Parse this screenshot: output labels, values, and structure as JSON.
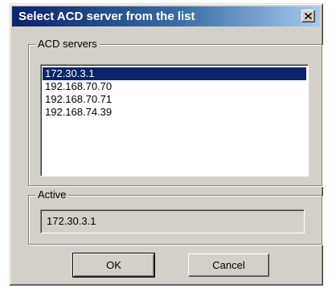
{
  "window": {
    "title": "Select ACD server from the list",
    "close_icon": "close-x"
  },
  "servers_group": {
    "label": "ACD servers",
    "items": [
      "172.30.3.1",
      "192.168.70.70",
      "192.168.70.71",
      "192.168.74.39"
    ],
    "selected_index": 0
  },
  "active_group": {
    "label": "Active",
    "value": "172.30.3.1"
  },
  "buttons": {
    "ok": "OK",
    "cancel": "Cancel"
  },
  "colors": {
    "title_start": "#0a246a",
    "title_end": "#a6caf0",
    "selection": "#0a246a",
    "face": "#d4d0c8"
  }
}
